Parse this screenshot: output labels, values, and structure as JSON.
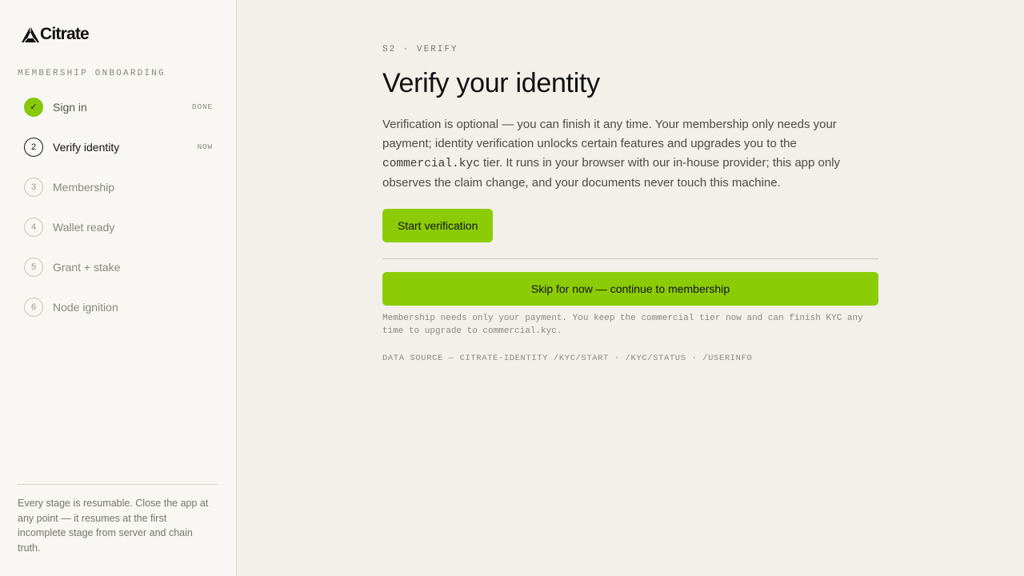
{
  "brand": {
    "name": "Citrate",
    "logo_icon": "citrate-logo-mark"
  },
  "sidebar": {
    "heading": "MEMBERSHIP ONBOARDING",
    "steps": [
      {
        "num": "✓",
        "label": "Sign in",
        "status": "DONE",
        "state": "done"
      },
      {
        "num": "2",
        "label": "Verify identity",
        "status": "NOW",
        "state": "current"
      },
      {
        "num": "3",
        "label": "Membership",
        "status": "",
        "state": "pending"
      },
      {
        "num": "4",
        "label": "Wallet ready",
        "status": "",
        "state": "pending"
      },
      {
        "num": "5",
        "label": "Grant + stake",
        "status": "",
        "state": "pending"
      },
      {
        "num": "6",
        "label": "Node ignition",
        "status": "",
        "state": "pending"
      }
    ],
    "note": "Every stage is resumable. Close the app at any point — it resumes at the first incomplete stage from server and chain truth."
  },
  "main": {
    "kicker": "S2 · VERIFY",
    "title": "Verify your identity",
    "description_part1": "Verification is optional — you can finish it any time. Your membership only needs your payment; identity verification unlocks certain features and upgrades you to the ",
    "description_code": "commercial.kyc",
    "description_part2": " tier. It runs in your browser with our in-house provider; this app only observes the claim change, and your documents never touch this machine.",
    "start_button": "Start verification",
    "skip_button": "Skip for now — continue to membership",
    "skip_note": "Membership needs only your payment. You keep the commercial tier now and can finish KYC any time to upgrade to commercial.kyc.",
    "data_source": "DATA SOURCE — CITRATE-IDENTITY /KYC/START · /KYC/STATUS · /USERINFO"
  },
  "colors": {
    "accent": "#8ccc06",
    "background": "#f3f0e9",
    "sidebar_background": "#f8f7f3"
  }
}
